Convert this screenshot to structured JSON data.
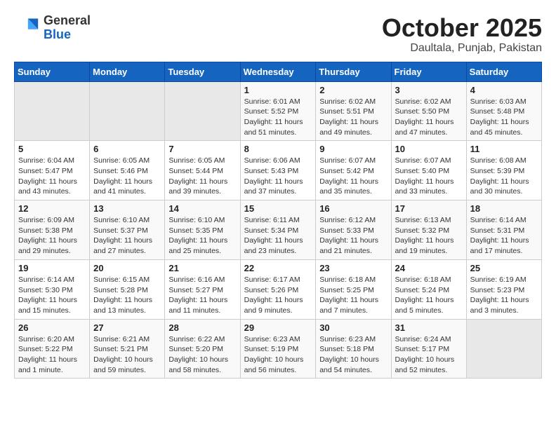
{
  "header": {
    "logo_line1": "General",
    "logo_line2": "Blue",
    "month": "October 2025",
    "location": "Daultala, Punjab, Pakistan"
  },
  "days_of_week": [
    "Sunday",
    "Monday",
    "Tuesday",
    "Wednesday",
    "Thursday",
    "Friday",
    "Saturday"
  ],
  "weeks": [
    [
      {
        "day": "",
        "info": ""
      },
      {
        "day": "",
        "info": ""
      },
      {
        "day": "",
        "info": ""
      },
      {
        "day": "1",
        "info": "Sunrise: 6:01 AM\nSunset: 5:52 PM\nDaylight: 11 hours\nand 51 minutes."
      },
      {
        "day": "2",
        "info": "Sunrise: 6:02 AM\nSunset: 5:51 PM\nDaylight: 11 hours\nand 49 minutes."
      },
      {
        "day": "3",
        "info": "Sunrise: 6:02 AM\nSunset: 5:50 PM\nDaylight: 11 hours\nand 47 minutes."
      },
      {
        "day": "4",
        "info": "Sunrise: 6:03 AM\nSunset: 5:48 PM\nDaylight: 11 hours\nand 45 minutes."
      }
    ],
    [
      {
        "day": "5",
        "info": "Sunrise: 6:04 AM\nSunset: 5:47 PM\nDaylight: 11 hours\nand 43 minutes."
      },
      {
        "day": "6",
        "info": "Sunrise: 6:05 AM\nSunset: 5:46 PM\nDaylight: 11 hours\nand 41 minutes."
      },
      {
        "day": "7",
        "info": "Sunrise: 6:05 AM\nSunset: 5:44 PM\nDaylight: 11 hours\nand 39 minutes."
      },
      {
        "day": "8",
        "info": "Sunrise: 6:06 AM\nSunset: 5:43 PM\nDaylight: 11 hours\nand 37 minutes."
      },
      {
        "day": "9",
        "info": "Sunrise: 6:07 AM\nSunset: 5:42 PM\nDaylight: 11 hours\nand 35 minutes."
      },
      {
        "day": "10",
        "info": "Sunrise: 6:07 AM\nSunset: 5:40 PM\nDaylight: 11 hours\nand 33 minutes."
      },
      {
        "day": "11",
        "info": "Sunrise: 6:08 AM\nSunset: 5:39 PM\nDaylight: 11 hours\nand 30 minutes."
      }
    ],
    [
      {
        "day": "12",
        "info": "Sunrise: 6:09 AM\nSunset: 5:38 PM\nDaylight: 11 hours\nand 29 minutes."
      },
      {
        "day": "13",
        "info": "Sunrise: 6:10 AM\nSunset: 5:37 PM\nDaylight: 11 hours\nand 27 minutes."
      },
      {
        "day": "14",
        "info": "Sunrise: 6:10 AM\nSunset: 5:35 PM\nDaylight: 11 hours\nand 25 minutes."
      },
      {
        "day": "15",
        "info": "Sunrise: 6:11 AM\nSunset: 5:34 PM\nDaylight: 11 hours\nand 23 minutes."
      },
      {
        "day": "16",
        "info": "Sunrise: 6:12 AM\nSunset: 5:33 PM\nDaylight: 11 hours\nand 21 minutes."
      },
      {
        "day": "17",
        "info": "Sunrise: 6:13 AM\nSunset: 5:32 PM\nDaylight: 11 hours\nand 19 minutes."
      },
      {
        "day": "18",
        "info": "Sunrise: 6:14 AM\nSunset: 5:31 PM\nDaylight: 11 hours\nand 17 minutes."
      }
    ],
    [
      {
        "day": "19",
        "info": "Sunrise: 6:14 AM\nSunset: 5:30 PM\nDaylight: 11 hours\nand 15 minutes."
      },
      {
        "day": "20",
        "info": "Sunrise: 6:15 AM\nSunset: 5:28 PM\nDaylight: 11 hours\nand 13 minutes."
      },
      {
        "day": "21",
        "info": "Sunrise: 6:16 AM\nSunset: 5:27 PM\nDaylight: 11 hours\nand 11 minutes."
      },
      {
        "day": "22",
        "info": "Sunrise: 6:17 AM\nSunset: 5:26 PM\nDaylight: 11 hours\nand 9 minutes."
      },
      {
        "day": "23",
        "info": "Sunrise: 6:18 AM\nSunset: 5:25 PM\nDaylight: 11 hours\nand 7 minutes."
      },
      {
        "day": "24",
        "info": "Sunrise: 6:18 AM\nSunset: 5:24 PM\nDaylight: 11 hours\nand 5 minutes."
      },
      {
        "day": "25",
        "info": "Sunrise: 6:19 AM\nSunset: 5:23 PM\nDaylight: 11 hours\nand 3 minutes."
      }
    ],
    [
      {
        "day": "26",
        "info": "Sunrise: 6:20 AM\nSunset: 5:22 PM\nDaylight: 11 hours\nand 1 minute."
      },
      {
        "day": "27",
        "info": "Sunrise: 6:21 AM\nSunset: 5:21 PM\nDaylight: 10 hours\nand 59 minutes."
      },
      {
        "day": "28",
        "info": "Sunrise: 6:22 AM\nSunset: 5:20 PM\nDaylight: 10 hours\nand 58 minutes."
      },
      {
        "day": "29",
        "info": "Sunrise: 6:23 AM\nSunset: 5:19 PM\nDaylight: 10 hours\nand 56 minutes."
      },
      {
        "day": "30",
        "info": "Sunrise: 6:23 AM\nSunset: 5:18 PM\nDaylight: 10 hours\nand 54 minutes."
      },
      {
        "day": "31",
        "info": "Sunrise: 6:24 AM\nSunset: 5:17 PM\nDaylight: 10 hours\nand 52 minutes."
      },
      {
        "day": "",
        "info": ""
      }
    ]
  ]
}
